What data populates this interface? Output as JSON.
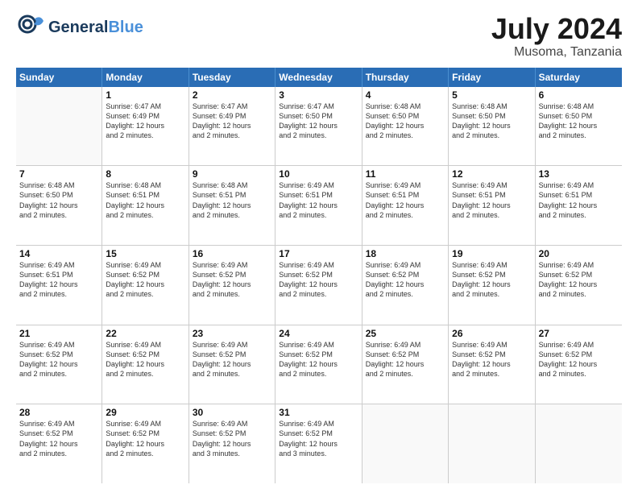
{
  "header": {
    "logo_general": "General",
    "logo_blue": "Blue",
    "title": "July 2024",
    "location": "Musoma, Tanzania"
  },
  "weekdays": [
    "Sunday",
    "Monday",
    "Tuesday",
    "Wednesday",
    "Thursday",
    "Friday",
    "Saturday"
  ],
  "rows": [
    [
      {
        "day": "",
        "info": ""
      },
      {
        "day": "1",
        "info": "Sunrise: 6:47 AM\nSunset: 6:49 PM\nDaylight: 12 hours\nand 2 minutes."
      },
      {
        "day": "2",
        "info": "Sunrise: 6:47 AM\nSunset: 6:49 PM\nDaylight: 12 hours\nand 2 minutes."
      },
      {
        "day": "3",
        "info": "Sunrise: 6:47 AM\nSunset: 6:50 PM\nDaylight: 12 hours\nand 2 minutes."
      },
      {
        "day": "4",
        "info": "Sunrise: 6:48 AM\nSunset: 6:50 PM\nDaylight: 12 hours\nand 2 minutes."
      },
      {
        "day": "5",
        "info": "Sunrise: 6:48 AM\nSunset: 6:50 PM\nDaylight: 12 hours\nand 2 minutes."
      },
      {
        "day": "6",
        "info": "Sunrise: 6:48 AM\nSunset: 6:50 PM\nDaylight: 12 hours\nand 2 minutes."
      }
    ],
    [
      {
        "day": "7",
        "info": "Sunrise: 6:48 AM\nSunset: 6:50 PM\nDaylight: 12 hours\nand 2 minutes."
      },
      {
        "day": "8",
        "info": "Sunrise: 6:48 AM\nSunset: 6:51 PM\nDaylight: 12 hours\nand 2 minutes."
      },
      {
        "day": "9",
        "info": "Sunrise: 6:48 AM\nSunset: 6:51 PM\nDaylight: 12 hours\nand 2 minutes."
      },
      {
        "day": "10",
        "info": "Sunrise: 6:49 AM\nSunset: 6:51 PM\nDaylight: 12 hours\nand 2 minutes."
      },
      {
        "day": "11",
        "info": "Sunrise: 6:49 AM\nSunset: 6:51 PM\nDaylight: 12 hours\nand 2 minutes."
      },
      {
        "day": "12",
        "info": "Sunrise: 6:49 AM\nSunset: 6:51 PM\nDaylight: 12 hours\nand 2 minutes."
      },
      {
        "day": "13",
        "info": "Sunrise: 6:49 AM\nSunset: 6:51 PM\nDaylight: 12 hours\nand 2 minutes."
      }
    ],
    [
      {
        "day": "14",
        "info": "Sunrise: 6:49 AM\nSunset: 6:51 PM\nDaylight: 12 hours\nand 2 minutes."
      },
      {
        "day": "15",
        "info": "Sunrise: 6:49 AM\nSunset: 6:52 PM\nDaylight: 12 hours\nand 2 minutes."
      },
      {
        "day": "16",
        "info": "Sunrise: 6:49 AM\nSunset: 6:52 PM\nDaylight: 12 hours\nand 2 minutes."
      },
      {
        "day": "17",
        "info": "Sunrise: 6:49 AM\nSunset: 6:52 PM\nDaylight: 12 hours\nand 2 minutes."
      },
      {
        "day": "18",
        "info": "Sunrise: 6:49 AM\nSunset: 6:52 PM\nDaylight: 12 hours\nand 2 minutes."
      },
      {
        "day": "19",
        "info": "Sunrise: 6:49 AM\nSunset: 6:52 PM\nDaylight: 12 hours\nand 2 minutes."
      },
      {
        "day": "20",
        "info": "Sunrise: 6:49 AM\nSunset: 6:52 PM\nDaylight: 12 hours\nand 2 minutes."
      }
    ],
    [
      {
        "day": "21",
        "info": "Sunrise: 6:49 AM\nSunset: 6:52 PM\nDaylight: 12 hours\nand 2 minutes."
      },
      {
        "day": "22",
        "info": "Sunrise: 6:49 AM\nSunset: 6:52 PM\nDaylight: 12 hours\nand 2 minutes."
      },
      {
        "day": "23",
        "info": "Sunrise: 6:49 AM\nSunset: 6:52 PM\nDaylight: 12 hours\nand 2 minutes."
      },
      {
        "day": "24",
        "info": "Sunrise: 6:49 AM\nSunset: 6:52 PM\nDaylight: 12 hours\nand 2 minutes."
      },
      {
        "day": "25",
        "info": "Sunrise: 6:49 AM\nSunset: 6:52 PM\nDaylight: 12 hours\nand 2 minutes."
      },
      {
        "day": "26",
        "info": "Sunrise: 6:49 AM\nSunset: 6:52 PM\nDaylight: 12 hours\nand 2 minutes."
      },
      {
        "day": "27",
        "info": "Sunrise: 6:49 AM\nSunset: 6:52 PM\nDaylight: 12 hours\nand 2 minutes."
      }
    ],
    [
      {
        "day": "28",
        "info": "Sunrise: 6:49 AM\nSunset: 6:52 PM\nDaylight: 12 hours\nand 2 minutes."
      },
      {
        "day": "29",
        "info": "Sunrise: 6:49 AM\nSunset: 6:52 PM\nDaylight: 12 hours\nand 2 minutes."
      },
      {
        "day": "30",
        "info": "Sunrise: 6:49 AM\nSunset: 6:52 PM\nDaylight: 12 hours\nand 3 minutes."
      },
      {
        "day": "31",
        "info": "Sunrise: 6:49 AM\nSunset: 6:52 PM\nDaylight: 12 hours\nand 3 minutes."
      },
      {
        "day": "",
        "info": ""
      },
      {
        "day": "",
        "info": ""
      },
      {
        "day": "",
        "info": ""
      }
    ]
  ]
}
